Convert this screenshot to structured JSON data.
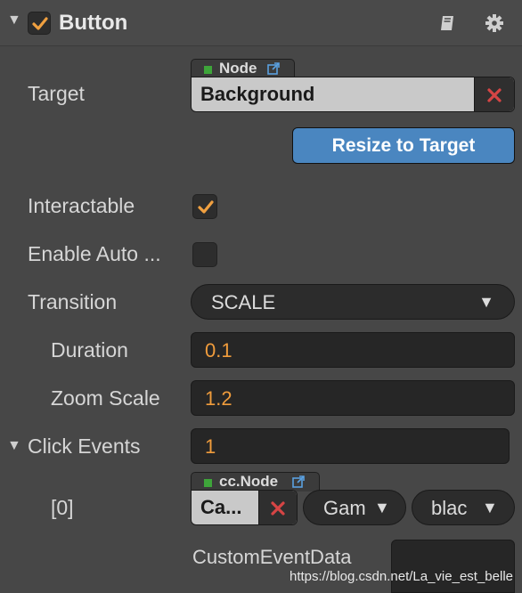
{
  "component": {
    "title": "Button",
    "enabled": true
  },
  "target": {
    "label": "Target",
    "type_tag": "Node",
    "value": "Background"
  },
  "resize_button": "Resize to Target",
  "interactable": {
    "label": "Interactable",
    "checked": true
  },
  "enable_auto": {
    "label": "Enable Auto ...",
    "checked": false
  },
  "transition": {
    "label": "Transition",
    "value": "SCALE"
  },
  "duration": {
    "label": "Duration",
    "value": "0.1"
  },
  "zoom_scale": {
    "label": "Zoom Scale",
    "value": "1.2"
  },
  "click_events": {
    "label": "Click Events",
    "count": "1",
    "item": {
      "index_label": "[0]",
      "type_tag": "cc.Node",
      "target_value": "Ca...",
      "component_value": "Gam",
      "handler_value": "blac",
      "custom_label": "CustomEventData",
      "custom_value": ""
    }
  },
  "watermark": "https://blog.csdn.net/La_vie_est_belle",
  "colors": {
    "accent_orange": "#f0a040",
    "button_blue": "#4a86c0",
    "node_green": "#3ea53a",
    "remove_red": "#d64545"
  },
  "icons": [
    "collapse-arrow-icon",
    "checkmark-icon",
    "book-icon",
    "gear-icon",
    "external-link-icon",
    "remove-x-icon",
    "dropdown-caret-icon"
  ]
}
